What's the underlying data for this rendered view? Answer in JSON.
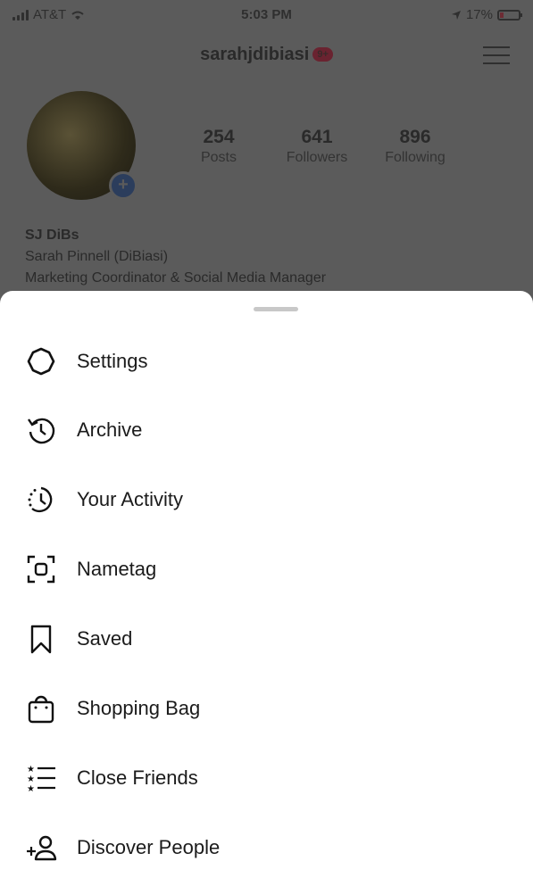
{
  "status_bar": {
    "carrier": "AT&T",
    "time": "5:03 PM",
    "battery": "17%"
  },
  "profile": {
    "username": "sarahjdibiasi",
    "notification_badge": "9+",
    "stats": [
      {
        "value": "254",
        "label": "Posts"
      },
      {
        "value": "641",
        "label": "Followers"
      },
      {
        "value": "896",
        "label": "Following"
      }
    ],
    "display_name": "SJ DiBs",
    "bio_line1": "Sarah Pinnell (DiBiasi)",
    "bio_line2": "Marketing Coordinator & Social Media Manager"
  },
  "menu": {
    "items": [
      {
        "label": "Settings",
        "icon": "settings-icon"
      },
      {
        "label": "Archive",
        "icon": "archive-icon"
      },
      {
        "label": "Your Activity",
        "icon": "activity-icon"
      },
      {
        "label": "Nametag",
        "icon": "nametag-icon"
      },
      {
        "label": "Saved",
        "icon": "bookmark-icon"
      },
      {
        "label": "Shopping Bag",
        "icon": "shopping-bag-icon"
      },
      {
        "label": "Close Friends",
        "icon": "close-friends-icon"
      },
      {
        "label": "Discover People",
        "icon": "add-person-icon"
      }
    ]
  }
}
